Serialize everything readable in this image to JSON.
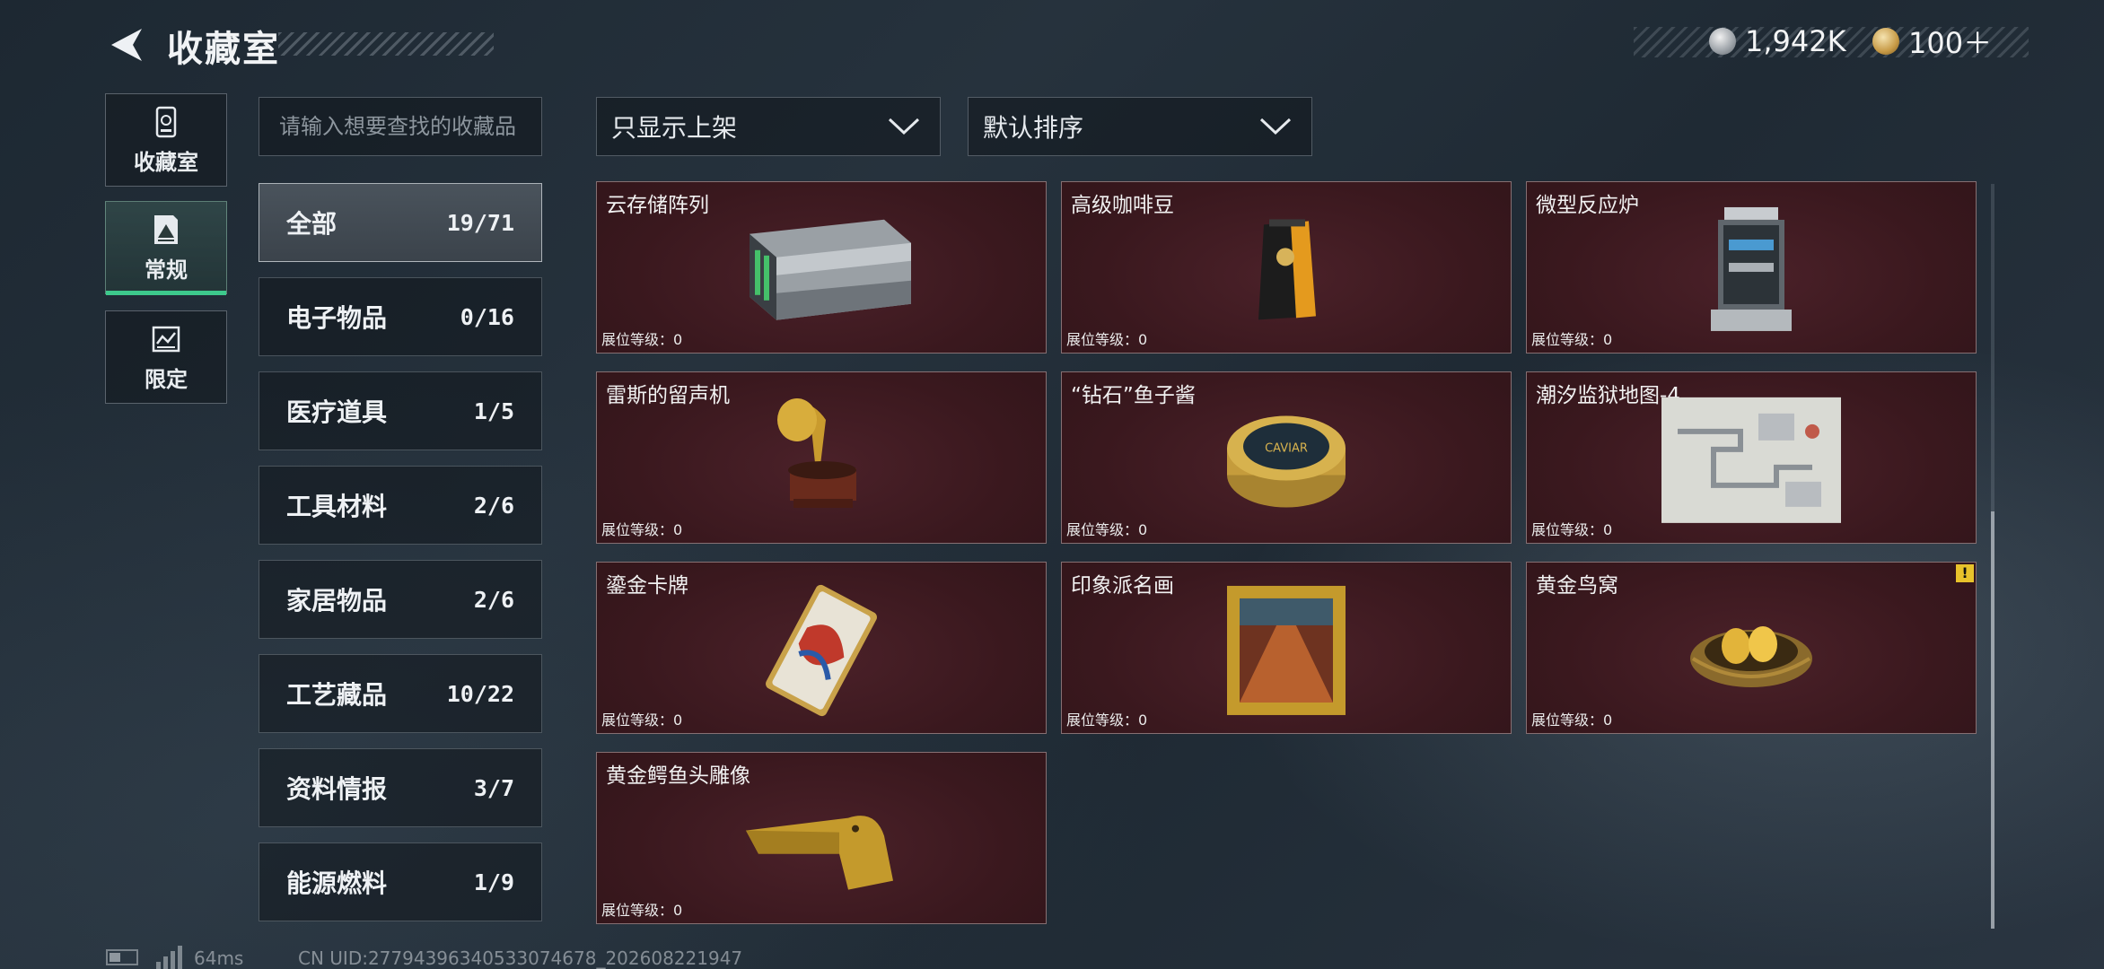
{
  "header": {
    "title": "收藏室",
    "back_icon": "back-arrow-icon",
    "currencies": [
      {
        "icon": "silver-coin-icon",
        "value": "1,942K"
      },
      {
        "icon": "gold-token-icon",
        "value": "100＋"
      }
    ]
  },
  "side_tabs": [
    {
      "label": "收藏室",
      "icon": "vault-icon",
      "active": false
    },
    {
      "label": "常规",
      "icon": "regular-doc-icon",
      "active": true
    },
    {
      "label": "限定",
      "icon": "limited-icon",
      "active": false
    }
  ],
  "search": {
    "placeholder": "请输入想要查找的收藏品",
    "value": ""
  },
  "filters": {
    "shelf_filter": "只显示上架",
    "sort": "默认排序"
  },
  "categories": [
    {
      "name": "全部",
      "count": "19/71",
      "active": true
    },
    {
      "name": "电子物品",
      "count": "0/16"
    },
    {
      "name": "医疗道具",
      "count": "1/5"
    },
    {
      "name": "工具材料",
      "count": "2/6"
    },
    {
      "name": "家居物品",
      "count": "2/6"
    },
    {
      "name": "工艺藏品",
      "count": "10/22"
    },
    {
      "name": "资料情报",
      "count": "3/7"
    },
    {
      "name": "能源燃料",
      "count": "1/9"
    }
  ],
  "items": [
    {
      "name": "云存储阵列",
      "level": "展位等级：0"
    },
    {
      "name": "高级咖啡豆",
      "level": "展位等级：0"
    },
    {
      "name": "微型反应炉",
      "level": "展位等级：0"
    },
    {
      "name": "雷斯的留声机",
      "level": "展位等级：0"
    },
    {
      "name": "“钻石”鱼子酱",
      "level": "展位等级：0",
      "art_label": "CAVIAR"
    },
    {
      "name": "潮汐监狱地图-4",
      "level": "展位等级：0"
    },
    {
      "name": "鎏金卡牌",
      "level": "展位等级：0"
    },
    {
      "name": "印象派名画",
      "level": "展位等级：0"
    },
    {
      "name": "黄金鸟窝",
      "level": "展位等级：0",
      "badge": "!"
    },
    {
      "name": "黄金鳄鱼头雕像",
      "level": "展位等级：0"
    }
  ],
  "footer": {
    "ping": "64ms",
    "uid": "CN UID:27794396340533074678_202608221947"
  },
  "colors": {
    "accent": "#3dc98c",
    "card": "#3a181e",
    "warning": "#e8c22b"
  }
}
